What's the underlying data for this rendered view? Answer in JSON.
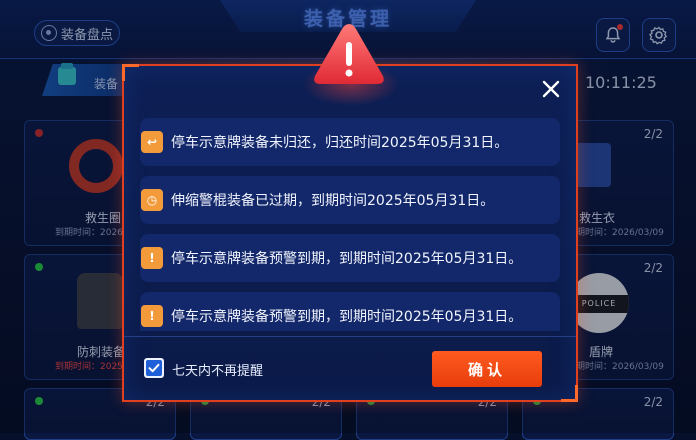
{
  "header": {
    "title": "装备管理",
    "inventory_label": "装备盘点",
    "bell_icon": "bell-icon",
    "settings_icon": "gear-icon"
  },
  "toolbar": {
    "tab_label": "装备",
    "time": "10:11:25"
  },
  "cards": [
    {
      "name": "救生圈",
      "date": "到期时间：2026",
      "count": "",
      "status_color": "#d23030"
    },
    {
      "name": "救生衣",
      "date": "到期时间：2026/03/09",
      "count": "2/2",
      "status_color": ""
    },
    {
      "name": "防刺装备",
      "date": "到期时间：2025",
      "count": "",
      "status_color": "#2ad14a"
    },
    {
      "name": "盾牌",
      "date": "到期时间：2026/03/09",
      "count": "2/2",
      "status_color": ""
    },
    {
      "name": "",
      "date": "",
      "count": "2/2",
      "status_color": "#2ad14a"
    },
    {
      "name": "",
      "date": "",
      "count": "2/2",
      "status_color": "#2ad14a"
    },
    {
      "name": "",
      "date": "",
      "count": "2/2",
      "status_color": "#2ad14a"
    },
    {
      "name": "",
      "date": "",
      "count": "2/2",
      "status_color": "#2ad14a"
    }
  ],
  "police_badge_text": "POLICE",
  "dialog": {
    "icon": "warning-triangle-icon",
    "close_icon": "close-icon",
    "messages": [
      {
        "icon": "return-icon",
        "text": "停车示意牌装备未归还，归还时间2025年05月31日。"
      },
      {
        "icon": "clock-expired-icon",
        "text": "伸缩警棍装备已过期，到期时间2025年05月31日。"
      },
      {
        "icon": "alarm-icon",
        "text": "停车示意牌装备预警到期，到期时间2025年05月31日。"
      },
      {
        "icon": "alarm-icon",
        "text": "停车示意牌装备预警到期，到期时间2025年05月31日。"
      }
    ],
    "checkbox_label": "七天内不再提醒",
    "checkbox_checked": true,
    "confirm_label": "确认"
  },
  "colors": {
    "accent": "#ff5a1f",
    "modal_border": "#e0401f",
    "message_icon": "#f39a3a"
  }
}
